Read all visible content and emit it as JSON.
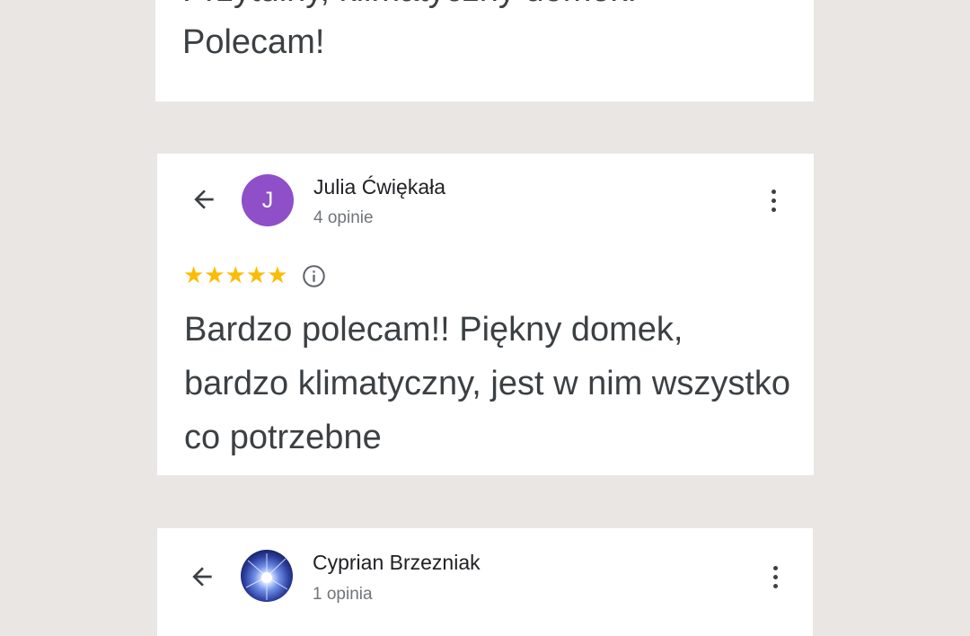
{
  "reviews": [
    {
      "text_visible": "Przytulny, klimatyczny domek. Polecam!",
      "first_line_partial": "Przytulny, klimatyczny domek.",
      "second_line": "Polecam!"
    },
    {
      "author": "Julia Ćwiękała",
      "avatar_letter": "J",
      "avatar_color": "#8e4fc8",
      "review_count": "4 opinie",
      "rating": 5,
      "stars": "★★★★★",
      "text": "Bardzo polecam!! Piękny domek, bardzo klimatyczny, jest w nim wszystko co potrzebne"
    },
    {
      "author": "Cyprian Brzezniak",
      "review_count": "1 opinia"
    }
  ],
  "icons": {
    "back": "arrow-left-icon",
    "more": "more-vert-icon",
    "info": "info-icon",
    "star": "star-icon"
  },
  "colors": {
    "background": "#e9e6e4",
    "card": "#ffffff",
    "star": "#fbbc04",
    "text": "#3c4043",
    "secondary_text": "#70757a"
  }
}
